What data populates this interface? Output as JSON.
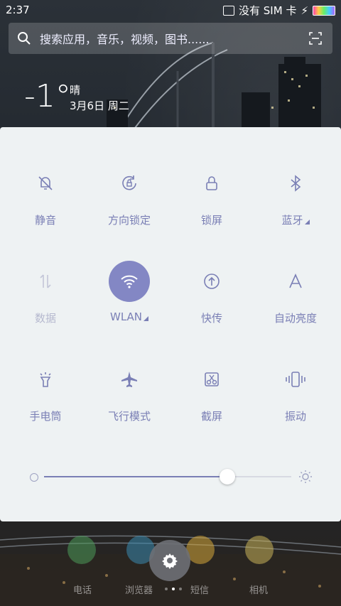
{
  "status_bar": {
    "time": "2:37",
    "sim_text": "没有 SIM 卡"
  },
  "search": {
    "placeholder": "搜索应用，音乐，视频，图书......"
  },
  "weather": {
    "temperature": "-1°",
    "condition": "晴",
    "date": "3月6日 周二"
  },
  "quick_settings": {
    "tiles": [
      {
        "label": "静音",
        "icon": "bell-off-icon",
        "active": false,
        "disabled": false
      },
      {
        "label": "方向锁定",
        "icon": "rotation-lock-icon",
        "active": false,
        "disabled": false
      },
      {
        "label": "锁屏",
        "icon": "lock-icon",
        "active": false,
        "disabled": false
      },
      {
        "label": "蓝牙",
        "icon": "bluetooth-icon",
        "active": false,
        "disabled": false
      },
      {
        "label": "数据",
        "icon": "mobile-data-icon",
        "active": false,
        "disabled": true
      },
      {
        "label": "WLAN",
        "icon": "wifi-icon",
        "active": true,
        "disabled": false
      },
      {
        "label": "快传",
        "icon": "quick-transfer-icon",
        "active": false,
        "disabled": false
      },
      {
        "label": "自动亮度",
        "icon": "auto-brightness-icon",
        "active": false,
        "disabled": false
      },
      {
        "label": "手电筒",
        "icon": "flashlight-icon",
        "active": false,
        "disabled": false
      },
      {
        "label": "飞行模式",
        "icon": "airplane-icon",
        "active": false,
        "disabled": false
      },
      {
        "label": "截屏",
        "icon": "screenshot-icon",
        "active": false,
        "disabled": false
      },
      {
        "label": "振动",
        "icon": "vibrate-icon",
        "active": false,
        "disabled": false
      }
    ],
    "brightness_level": 0.74
  },
  "dock": {
    "labels": [
      "电话",
      "浏览器",
      "短信",
      "相机"
    ]
  },
  "colors": {
    "accent": "#8387c4",
    "panel_bg": "#eef2f3",
    "label": "#7a7fb5"
  }
}
